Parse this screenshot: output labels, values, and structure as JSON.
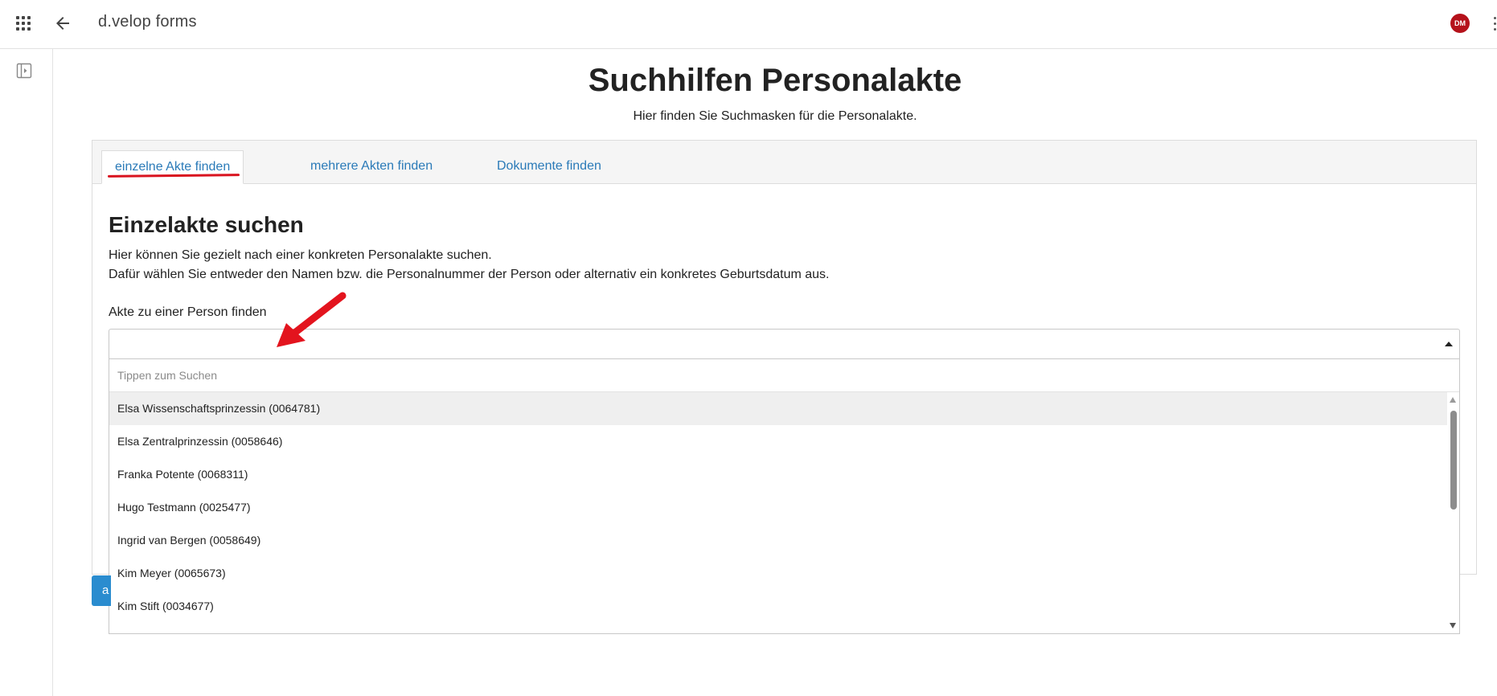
{
  "topbar": {
    "app_title": "d.velop forms",
    "avatar_initials": "DM",
    "icons": {
      "apps": "grid-apps-icon",
      "back": "arrow-left-icon",
      "more": "more-vertical-icon"
    }
  },
  "left_rail": {
    "icons": {
      "panel": "sidebar-panel-icon"
    }
  },
  "page": {
    "title": "Suchhilfen Personalakte",
    "subtitle": "Hier finden Sie Suchmasken für die Personalakte."
  },
  "tabs": [
    {
      "label": "einzelne Akte finden",
      "active": true
    },
    {
      "label": "mehrere Akten finden",
      "active": false
    },
    {
      "label": "Dokumente finden",
      "active": false
    }
  ],
  "section": {
    "heading": "Einzelakte suchen",
    "desc1": "Hier können Sie gezielt nach einer konkreten Personalakte suchen.",
    "desc2": "Dafür wählen Sie entweder den Namen bzw. die Personalnummer der Person oder alternativ ein konkretes Geburtsdatum aus.",
    "field_label": "Akte zu einer Person finden"
  },
  "select": {
    "value": "",
    "search_placeholder": "Tippen zum Suchen",
    "options": [
      "Elsa Wissenschaftsprinzessin (0064781)",
      "Elsa Zentralprinzessin (0058646)",
      "Franka Potente (0068311)",
      "Hugo Testmann (0025477)",
      "Ingrid van Bergen (0058649)",
      "Kim Meyer (0065673)",
      "Kim Stift (0034677)"
    ],
    "highlighted_index": 0
  },
  "button": {
    "label_partial": "a"
  },
  "colors": {
    "accent_link": "#2a7ab8",
    "annotation_red": "#d9131f",
    "avatar_bg": "#b5121b",
    "button_blue": "#2a8ccf"
  }
}
